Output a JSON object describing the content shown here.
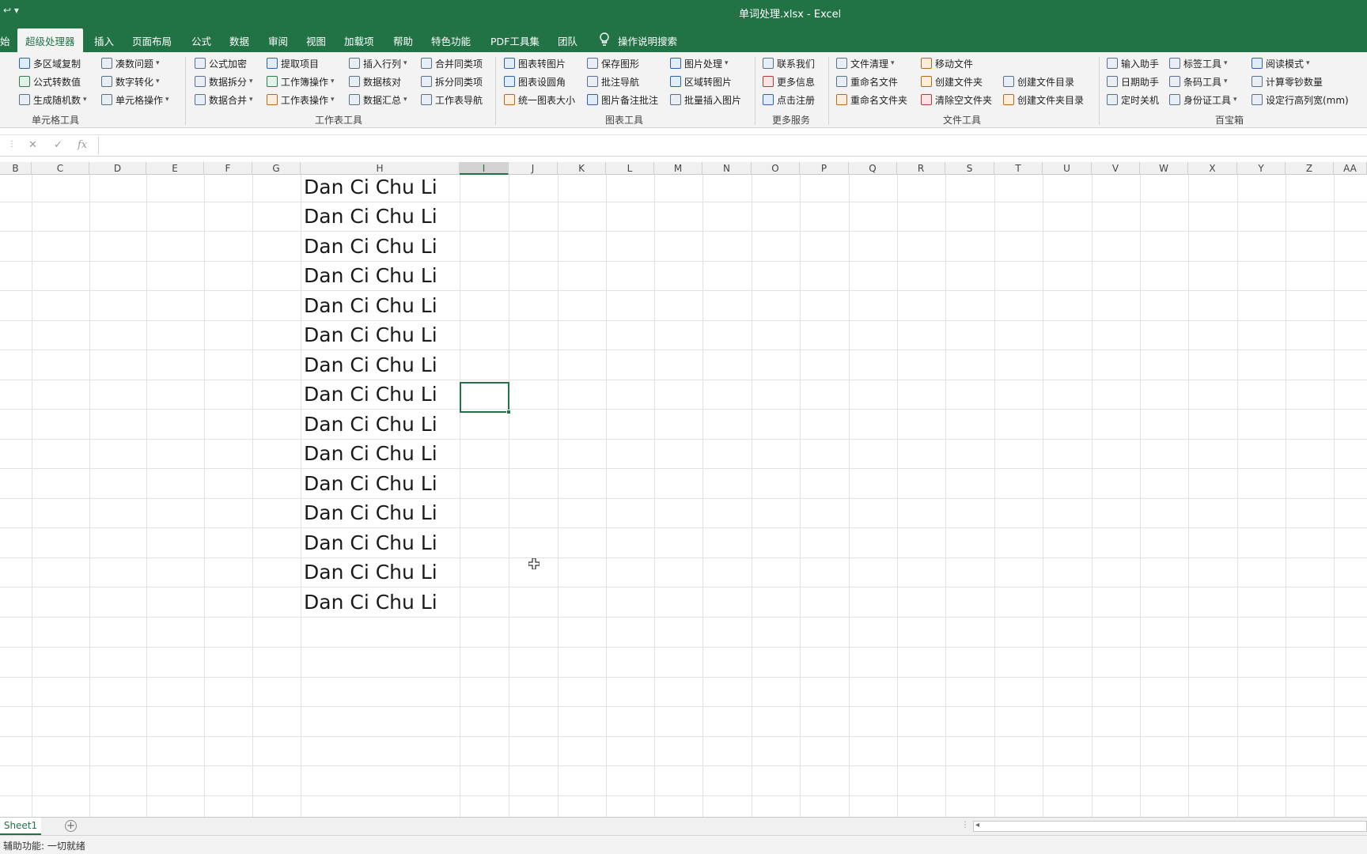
{
  "window": {
    "title": "单词处理.xlsx  -  Excel",
    "qat_glyph": "↩ ▾"
  },
  "tabs": [
    {
      "label": "始"
    },
    {
      "label": "超级处理器",
      "active": true
    },
    {
      "label": "插入"
    },
    {
      "label": "页面布局"
    },
    {
      "label": "公式"
    },
    {
      "label": "数据"
    },
    {
      "label": "审阅"
    },
    {
      "label": "视图"
    },
    {
      "label": "加载项"
    },
    {
      "label": "帮助"
    },
    {
      "label": "特色功能"
    },
    {
      "label": "PDF工具集"
    },
    {
      "label": "团队"
    },
    {
      "label": "操作说明搜索"
    }
  ],
  "ribbon": {
    "groups": [
      {
        "label": "单元格工具",
        "items": [
          "多区域复制",
          "公式转数值",
          "生成随机数",
          "凑数问题",
          "数字转化",
          "单元格操作"
        ]
      },
      {
        "label": "工作表工具",
        "items": [
          "公式加密",
          "数据拆分",
          "数据合并",
          "提取项目",
          "工作簿操作",
          "工作表操作",
          "插入行列",
          "数据核对",
          "数据汇总",
          "合并同类项",
          "拆分同类项",
          "工作表导航"
        ]
      },
      {
        "label": "图表工具",
        "items": [
          "图表转图片",
          "图表设圆角",
          "统一图表大小",
          "保存图形",
          "批注导航",
          "图片备注批注",
          "图片处理",
          "区域转图片",
          "批量插入图片"
        ]
      },
      {
        "label": "更多服务",
        "items": [
          "联系我们",
          "更多信息",
          "点击注册"
        ]
      },
      {
        "label": "文件工具",
        "items": [
          "文件清理",
          "重命名文件",
          "重命名文件夹",
          "移动文件",
          "创建文件夹",
          "清除空文件夹",
          "创建文件目录",
          "创建文件夹目录"
        ]
      },
      {
        "label": "百宝箱",
        "items": [
          "输入助手",
          "日期助手",
          "定时关机",
          "标签工具",
          "条码工具",
          "身份证工具",
          "阅读模式",
          "计算零钞数量",
          "设定行高列宽(mm)"
        ]
      }
    ]
  },
  "formula_bar": {
    "cancel": "✕",
    "confirm": "✓",
    "fx": "fx",
    "dots": "⋮",
    "value": ""
  },
  "columns": [
    "B",
    "C",
    "D",
    "E",
    "F",
    "G",
    "H",
    "I",
    "J",
    "K",
    "L",
    "M",
    "N",
    "O",
    "P",
    "Q",
    "R",
    "S",
    "T",
    "U",
    "V",
    "W",
    "X",
    "Y",
    "Z",
    "AA"
  ],
  "selected_column": "I",
  "cells_h": [
    "Dan Ci Chu Li",
    "Dan Ci Chu Li",
    "Dan Ci Chu Li",
    "Dan Ci Chu Li",
    "Dan Ci Chu Li",
    "Dan Ci Chu Li",
    "Dan Ci Chu Li",
    "Dan Ci Chu Li",
    "Dan Ci Chu Li",
    "Dan Ci Chu Li",
    "Dan Ci Chu Li",
    "Dan Ci Chu Li",
    "Dan Ci Chu Li",
    "Dan Ci Chu Li",
    "Dan Ci Chu Li"
  ],
  "sheets": [
    {
      "name": "Sheet1",
      "active": true
    }
  ],
  "add_sheet_glyph": "+",
  "scroll_glyph": "◂",
  "status": "辅助功能: 一切就绪",
  "colors": {
    "accent": "#217346"
  }
}
